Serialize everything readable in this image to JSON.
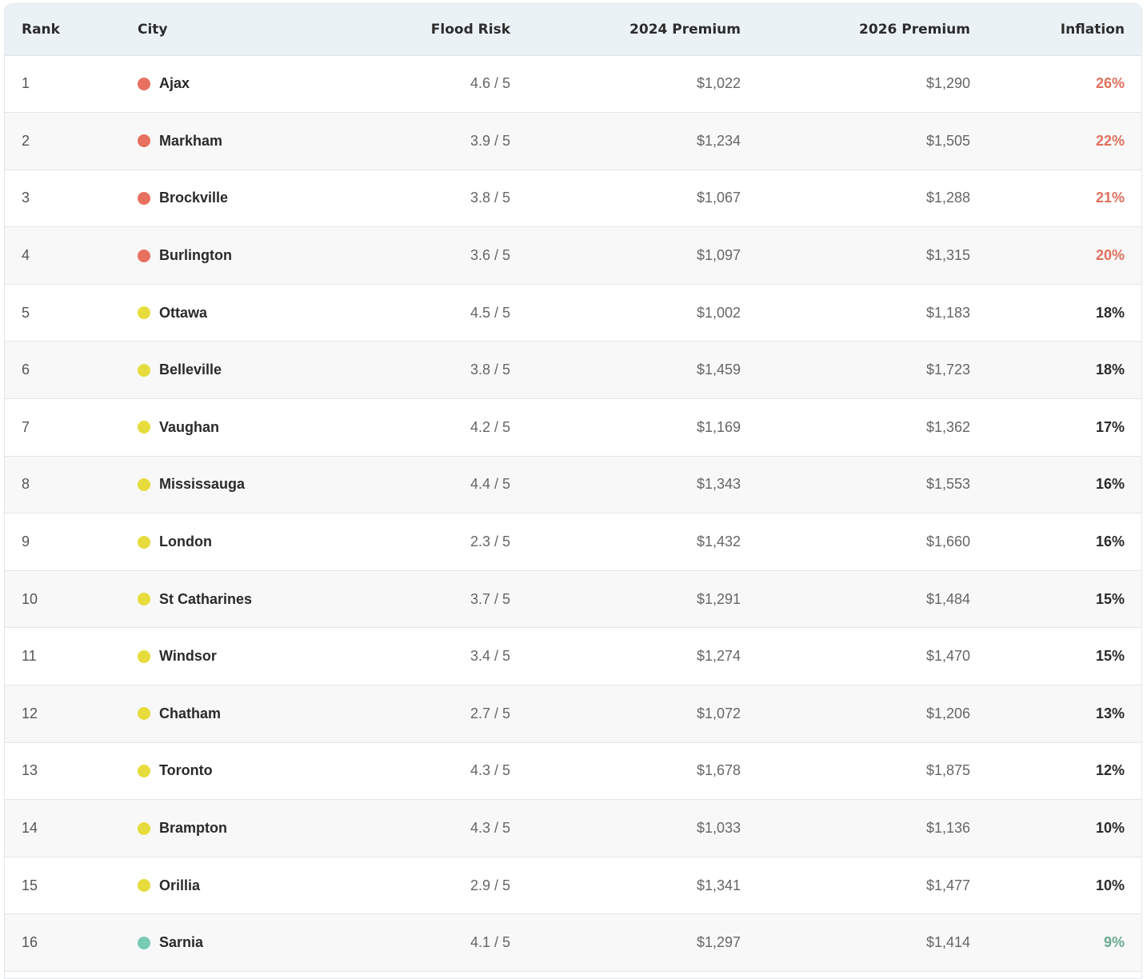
{
  "colors": {
    "high": "#e8705f",
    "medium": "#e6dc3c",
    "low": "#77cbb3",
    "infl_high": "#e0705e",
    "infl_medium": "#2a2a2a",
    "infl_low": "#6aaa90"
  },
  "table": {
    "headers": {
      "rank": "Rank",
      "city": "City",
      "flood": "Flood Risk",
      "p2024": "2024 Premium",
      "p2026": "2026 Premium",
      "inflation": "Inflation"
    },
    "rows": [
      {
        "rank": "1",
        "city": "Ajax",
        "level": "high",
        "flood": "4.6 / 5",
        "p2024": "$1,022",
        "p2026": "$1,290",
        "inflation": "26%"
      },
      {
        "rank": "2",
        "city": "Markham",
        "level": "high",
        "flood": "3.9 / 5",
        "p2024": "$1,234",
        "p2026": "$1,505",
        "inflation": "22%"
      },
      {
        "rank": "3",
        "city": "Brockville",
        "level": "high",
        "flood": "3.8 / 5",
        "p2024": "$1,067",
        "p2026": "$1,288",
        "inflation": "21%"
      },
      {
        "rank": "4",
        "city": "Burlington",
        "level": "high",
        "flood": "3.6 / 5",
        "p2024": "$1,097",
        "p2026": "$1,315",
        "inflation": "20%"
      },
      {
        "rank": "5",
        "city": "Ottawa",
        "level": "medium",
        "flood": "4.5 / 5",
        "p2024": "$1,002",
        "p2026": "$1,183",
        "inflation": "18%"
      },
      {
        "rank": "6",
        "city": "Belleville",
        "level": "medium",
        "flood": "3.8 / 5",
        "p2024": "$1,459",
        "p2026": "$1,723",
        "inflation": "18%"
      },
      {
        "rank": "7",
        "city": "Vaughan",
        "level": "medium",
        "flood": "4.2 / 5",
        "p2024": "$1,169",
        "p2026": "$1,362",
        "inflation": "17%"
      },
      {
        "rank": "8",
        "city": "Mississauga",
        "level": "medium",
        "flood": "4.4 / 5",
        "p2024": "$1,343",
        "p2026": "$1,553",
        "inflation": "16%"
      },
      {
        "rank": "9",
        "city": "London",
        "level": "medium",
        "flood": "2.3 / 5",
        "p2024": "$1,432",
        "p2026": "$1,660",
        "inflation": "16%"
      },
      {
        "rank": "10",
        "city": "St Catharines",
        "level": "medium",
        "flood": "3.7 / 5",
        "p2024": "$1,291",
        "p2026": "$1,484",
        "inflation": "15%"
      },
      {
        "rank": "11",
        "city": "Windsor",
        "level": "medium",
        "flood": "3.4 / 5",
        "p2024": "$1,274",
        "p2026": "$1,470",
        "inflation": "15%"
      },
      {
        "rank": "12",
        "city": "Chatham",
        "level": "medium",
        "flood": "2.7 / 5",
        "p2024": "$1,072",
        "p2026": "$1,206",
        "inflation": "13%"
      },
      {
        "rank": "13",
        "city": "Toronto",
        "level": "medium",
        "flood": "4.3 / 5",
        "p2024": "$1,678",
        "p2026": "$1,875",
        "inflation": "12%"
      },
      {
        "rank": "14",
        "city": "Brampton",
        "level": "medium",
        "flood": "4.3 / 5",
        "p2024": "$1,033",
        "p2026": "$1,136",
        "inflation": "10%"
      },
      {
        "rank": "15",
        "city": "Orillia",
        "level": "medium",
        "flood": "2.9 / 5",
        "p2024": "$1,341",
        "p2026": "$1,477",
        "inflation": "10%"
      },
      {
        "rank": "16",
        "city": "Sarnia",
        "level": "low",
        "flood": "4.1 / 5",
        "p2024": "$1,297",
        "p2026": "$1,414",
        "inflation": "9%"
      }
    ]
  }
}
